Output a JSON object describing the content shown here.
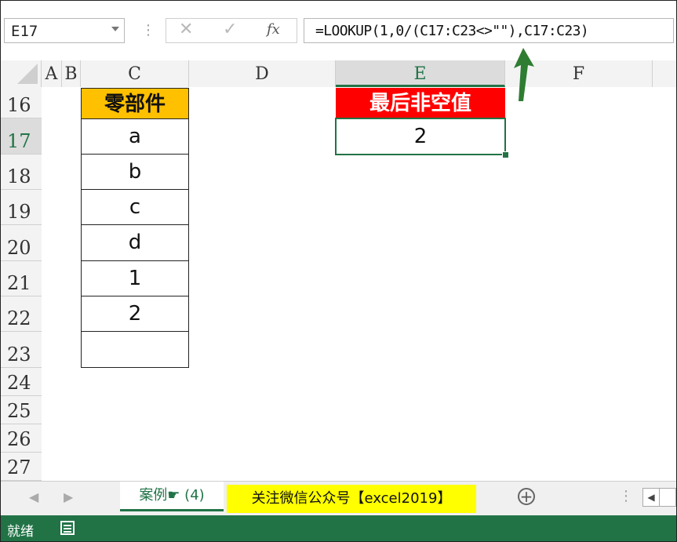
{
  "formula_bar": {
    "name_box": "E17",
    "more_icon": "⋮",
    "cancel_icon": "✕",
    "enter_icon": "✓",
    "fx_label": "fx",
    "formula": "=LOOKUP(1,0/(C17:C23<>\"\"),C17:C23)"
  },
  "columns": [
    "A",
    "B",
    "C",
    "D",
    "E",
    "F"
  ],
  "rows": [
    "16",
    "17",
    "18",
    "19",
    "20",
    "21",
    "22",
    "23",
    "24",
    "25",
    "26",
    "27"
  ],
  "active_cell": "E17",
  "table": {
    "header": "零部件",
    "values": [
      "a",
      "b",
      "c",
      "d",
      "1",
      "2",
      ""
    ]
  },
  "result": {
    "header": "最后非空值",
    "value": "2"
  },
  "annotation": {
    "arrow_color": "#2e7d32"
  },
  "sheet_tabs": [
    {
      "label": "案例☛ (4)",
      "active": true
    },
    {
      "label": "关注微信公众号【excel2019】",
      "active": false,
      "highlight": "#ffff00"
    }
  ],
  "tab_bar": {
    "prev_icon": "◀",
    "next_icon": "▶",
    "add_icon": "+",
    "more_icon": "⋮",
    "scroll_left_icon": "◀"
  },
  "status_bar": {
    "text": "就绪"
  },
  "colors": {
    "excel_green": "#217346",
    "header_orange": "#ffc000",
    "header_red": "#ff0000"
  }
}
